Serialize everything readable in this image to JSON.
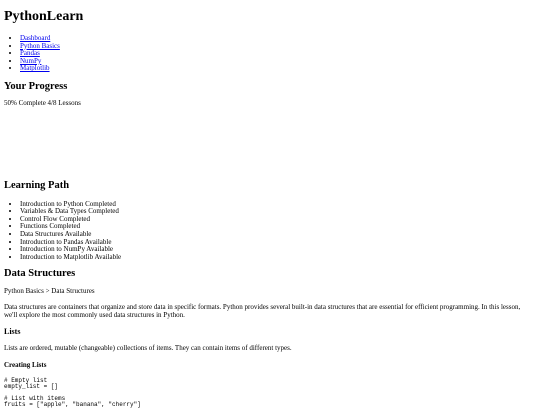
{
  "app": {
    "title": "PythonLearn"
  },
  "nav": {
    "items": [
      {
        "label": "Dashboard"
      },
      {
        "label": "Python Basics"
      },
      {
        "label": "Pandas"
      },
      {
        "label": "NumPy"
      },
      {
        "label": "Matplotlib"
      }
    ]
  },
  "progress": {
    "heading": "Your Progress",
    "text": "50% Complete 4/8 Lessons",
    "percent": 50,
    "completed_lessons": 4,
    "total_lessons": 8
  },
  "learning_path": {
    "heading": "Learning Path",
    "items": [
      {
        "label": "Introduction to Python Completed"
      },
      {
        "label": "Variables & Data Types Completed"
      },
      {
        "label": "Control Flow Completed"
      },
      {
        "label": "Functions Completed"
      },
      {
        "label": "Data Structures Available"
      },
      {
        "label": "Introduction to Pandas Available"
      },
      {
        "label": "Introduction to NumPy Available"
      },
      {
        "label": "Introduction to Matplotlib Available"
      }
    ]
  },
  "lesson": {
    "title": "Data Structures",
    "breadcrumb": "Python Basics > Data Structures",
    "intro": "Data structures are containers that organize and store data in specific formats. Python provides several built-in data structures that are essential for efficient programming. In this lesson, we'll explore the most commonly used data structures in Python.",
    "lists": {
      "heading": "Lists",
      "description": "Lists are ordered, mutable (changeable) collections of items. They can contain items of different types.",
      "creating_heading": "Creating Lists",
      "code": "# Empty list\nempty_list = []\n\n# List with items\nfruits = [\"apple\", \"banana\", \"cherry\"]"
    }
  }
}
